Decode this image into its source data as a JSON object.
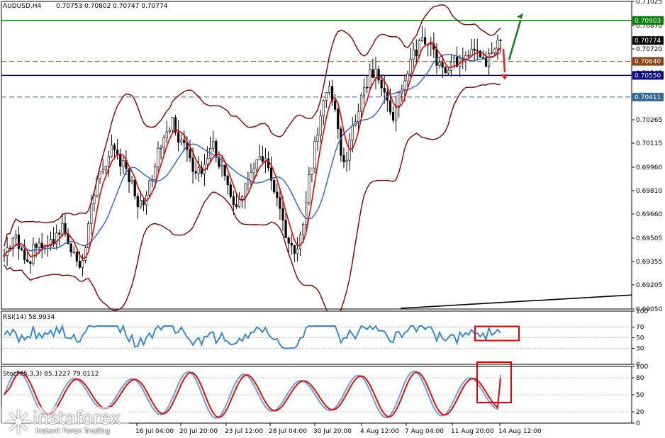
{
  "header": {
    "symbol_tf": "AUDUSD,H4",
    "ohlc": "0.70753 0.70802 0.70747 0.70774",
    "rsi_title": "RSI(14) 58.9934",
    "stoch_title": "Stoch(5,3,3) 85.1227 79.0112"
  },
  "watermark": {
    "brand": "instaforex",
    "tagline": "Instant Forex Trading"
  },
  "chart_data": [
    {
      "type": "candlestick",
      "symbol": "AUDUSD",
      "timeframe": "H4",
      "ylim": [
        0.6905,
        0.71025
      ],
      "price_ticks": [
        "0.71025",
        "0.70870",
        "0.70720",
        "0.70565",
        "0.70415",
        "0.70265",
        "0.70115",
        "0.69960",
        "0.69810",
        "0.69660",
        "0.69505",
        "0.69355",
        "0.69205",
        "0.69050"
      ],
      "x_labels": [
        "16 Jul 04:00",
        "20 Jul 20:00",
        "23 Jul 12:00",
        "28 Jul 04:00",
        "30 Jul 20:00",
        "4 Aug 12:00",
        "7 Aug 04:00",
        "11 Aug 20:00",
        "14 Aug 12:00"
      ],
      "current_price": "0.70774",
      "levels": [
        {
          "value": 0.70903,
          "label": "0.70903",
          "style": "solid",
          "color": "#008000"
        },
        {
          "value": 0.7064,
          "label": "0.70640",
          "style": "dashed",
          "color": "#8B4513"
        },
        {
          "value": 0.7055,
          "label": "0.70550",
          "style": "solid",
          "color": "#000080"
        },
        {
          "value": 0.70411,
          "label": "0.70411",
          "style": "dashed",
          "color": "#336699"
        }
      ],
      "price_path": [
        0.6938,
        0.6946,
        0.6952,
        0.694,
        0.6932,
        0.6944,
        0.695,
        0.6942,
        0.6948,
        0.6953,
        0.6957,
        0.6948,
        0.694,
        0.693,
        0.6945,
        0.697,
        0.6985,
        0.6995,
        0.7005,
        0.701,
        0.7,
        0.6995,
        0.6985,
        0.6975,
        0.697,
        0.6985,
        0.6998,
        0.701,
        0.7015,
        0.7025,
        0.7015,
        0.7008,
        0.7,
        0.6995,
        0.699,
        0.7005,
        0.701,
        0.7,
        0.699,
        0.6975,
        0.697,
        0.6978,
        0.6985,
        0.6995,
        0.7005,
        0.7,
        0.699,
        0.6975,
        0.696,
        0.6948,
        0.694,
        0.695,
        0.6975,
        0.7,
        0.702,
        0.704,
        0.705,
        0.703,
        0.7005,
        0.7,
        0.702,
        0.7035,
        0.7045,
        0.7055,
        0.706,
        0.7045,
        0.7035,
        0.703,
        0.704,
        0.7055,
        0.7065,
        0.707,
        0.708,
        0.7075,
        0.707,
        0.706,
        0.7055,
        0.706,
        0.7065,
        0.7063,
        0.707,
        0.7072,
        0.7065,
        0.7063,
        0.7068,
        0.7077
      ],
      "trendline": {
        "from": 0.6905,
        "to": 0.6914
      },
      "arrows": [
        {
          "direction": "up",
          "color": "#1a7a1a"
        },
        {
          "direction": "down",
          "color": "#e02020"
        }
      ]
    },
    {
      "type": "line",
      "name": "RSI(14)",
      "value": 58.9934,
      "ylim": [
        0,
        100
      ],
      "ticks": [
        "100",
        "70",
        "50",
        "30",
        "0"
      ],
      "levels": [
        70,
        50,
        30
      ]
    },
    {
      "type": "line",
      "name": "Stoch(5,3,3)",
      "main": 85.1227,
      "signal": 79.0112,
      "ylim": [
        0,
        100
      ],
      "ticks": [
        "100",
        "80",
        "50",
        "20",
        "0"
      ],
      "levels": [
        80,
        50,
        20
      ]
    }
  ],
  "colors": {
    "candle": "#000000",
    "bands": "#7a0000",
    "ma_fast": "#e00000",
    "ma_slow": "#3060c0",
    "rsi": "#3a86d6",
    "stoch_main": "#6f9fd8",
    "stoch_signal": "#dd1010",
    "highlight_box": "#e00000"
  }
}
